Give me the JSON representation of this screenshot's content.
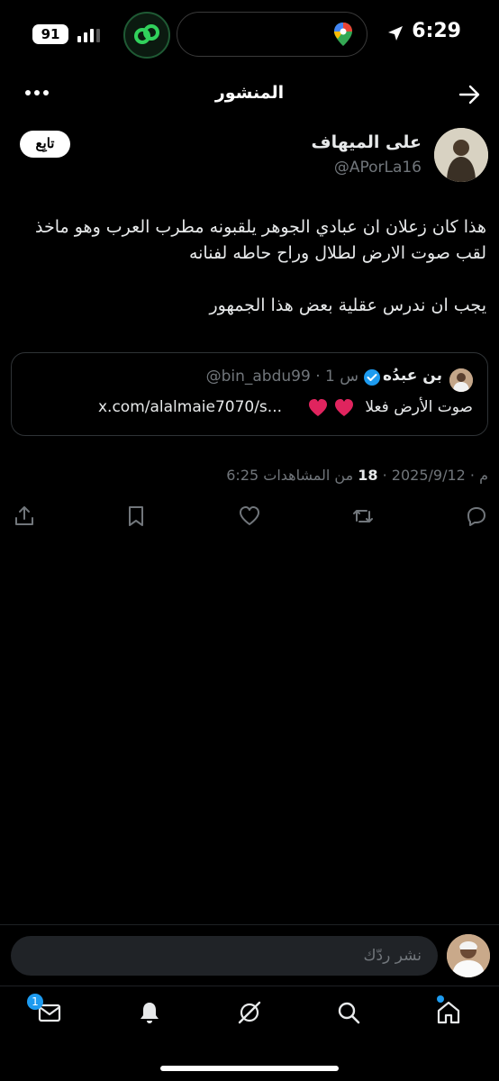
{
  "status_bar": {
    "time": "6:29",
    "battery": "91",
    "icons": [
      "location-arrow-icon",
      "signal-icon",
      "link-app-icon",
      "maps-icon"
    ]
  },
  "header": {
    "title": "المنشور",
    "back_icon": "arrow-right-icon",
    "more_icon": "more-horizontal-icon"
  },
  "post": {
    "author_name": "على الميهاف",
    "author_handle": "@APorLa16",
    "follow_label": "تابِع",
    "text": "هذا كان زعلان ان عبادي الجوهر يلقبونه مطرب العرب وهو ماخذ لقب صوت الارض لطلال وراح حاطه لفنانه\n\nيجب ان ندرس عقلية بعض هذا الجمهور",
    "quote": {
      "name": "بن عبدُه",
      "handle": "@bin_abdu99 · 1 س",
      "text": "صوت الأرض فعلا",
      "link": "x.com/alalmaie7070/s...",
      "heart_color": "#e0245e"
    },
    "meta": {
      "date": "6:25 م · 2025/9/12 · ",
      "views_count": "18",
      "views_label": " من المشاهدات"
    },
    "actions": [
      "reply-icon",
      "repost-icon",
      "like-icon",
      "bookmark-icon",
      "share-icon"
    ]
  },
  "reply": {
    "placeholder": "نشر ردّك"
  },
  "bottom_nav": {
    "items": [
      "home-icon",
      "search-icon",
      "grok-icon",
      "notifications-icon",
      "messages-icon"
    ],
    "messages_badge": "1"
  },
  "colors": {
    "accent": "#1d9bf0",
    "muted": "#71767b",
    "background": "#000000"
  }
}
